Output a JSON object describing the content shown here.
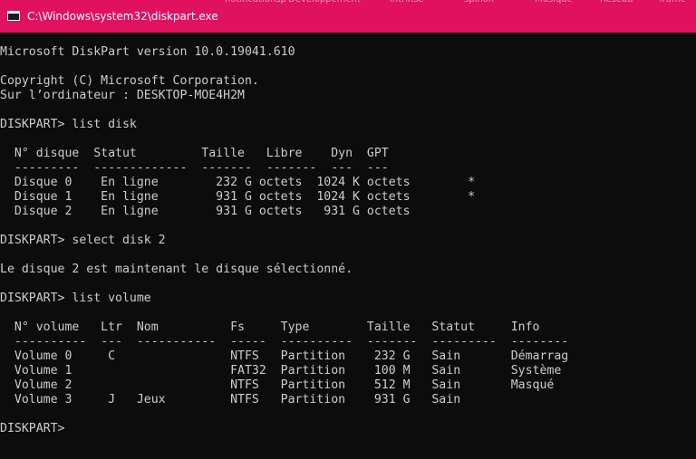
{
  "window": {
    "title": "C:\\Windows\\system32\\diskpart.exe",
    "titlebar_color": "#e0115f",
    "background_tabs": [
      "notificationsp",
      "Developpement",
      "intrinsè",
      "spinoff",
      "Musique",
      "Réseau",
      "Trame"
    ]
  },
  "console": {
    "background": "#0c0c0c",
    "text_color": "#cccccc",
    "lines": [
      "Microsoft DiskPart version 10.0.19041.610",
      "",
      "Copyright (C) Microsoft Corporation.",
      "Sur l’ordinateur : DESKTOP-MOE4H2M",
      "",
      "DISKPART> list disk",
      "",
      "  N° disque  Statut         Taille   Libre    Dyn  GPT",
      "  ---------  -------------  -------  -------  ---  ---",
      "  Disque 0    En ligne        232 G octets  1024 K octets        *",
      "  Disque 1    En ligne        931 G octets  1024 K octets        *",
      "  Disque 2    En ligne        931 G octets   931 G octets",
      "",
      "DISKPART> select disk 2",
      "",
      "Le disque 2 est maintenant le disque sélectionné.",
      "",
      "DISKPART> list volume",
      "",
      "  N° volume   Ltr  Nom          Fs     Type        Taille   Statut     Info",
      "  ----------  ---  -----------  -----  ----------  -------  ---------  --------",
      "  Volume 0     C                NTFS   Partition    232 G   Sain       Démarrag",
      "  Volume 1                      FAT32  Partition    100 M   Sain       Système",
      "  Volume 2                      NTFS   Partition    512 M   Sain       Masqué",
      "  Volume 3     J   Jeux         NTFS   Partition    931 G   Sain",
      "",
      "DISKPART> "
    ]
  }
}
